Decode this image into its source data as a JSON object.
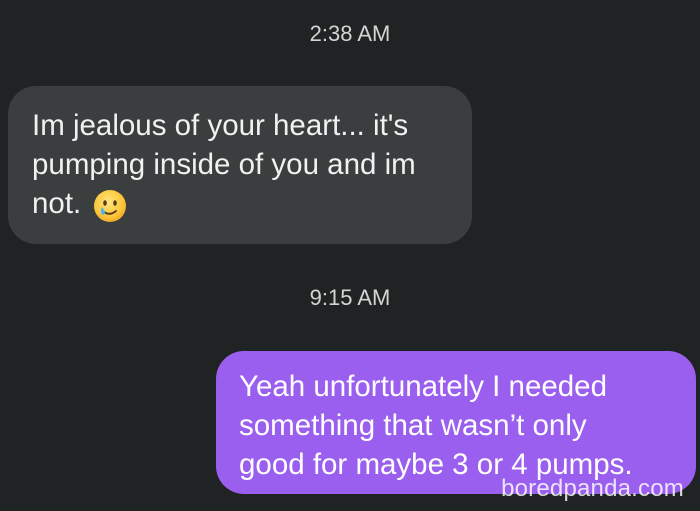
{
  "conversation": {
    "messages": [
      {
        "timestamp": "2:38 AM",
        "direction": "incoming",
        "lines": [
          "Im jealous of your heart... it's",
          "pumping inside of you and im",
          "not."
        ],
        "emoji": "smiling-face-with-tear"
      },
      {
        "timestamp": "9:15 AM",
        "direction": "outgoing",
        "lines": [
          "Yeah unfortunately I needed",
          "something that wasn’t only",
          "good for maybe 3 or 4 pumps."
        ]
      }
    ]
  },
  "watermark": "boredpanda.com",
  "colors": {
    "background": "#202323",
    "incoming_bubble": "#3b3e3e",
    "outgoing_bubble": "#9b5ff0",
    "timestamp_text": "#d4d4d4"
  }
}
